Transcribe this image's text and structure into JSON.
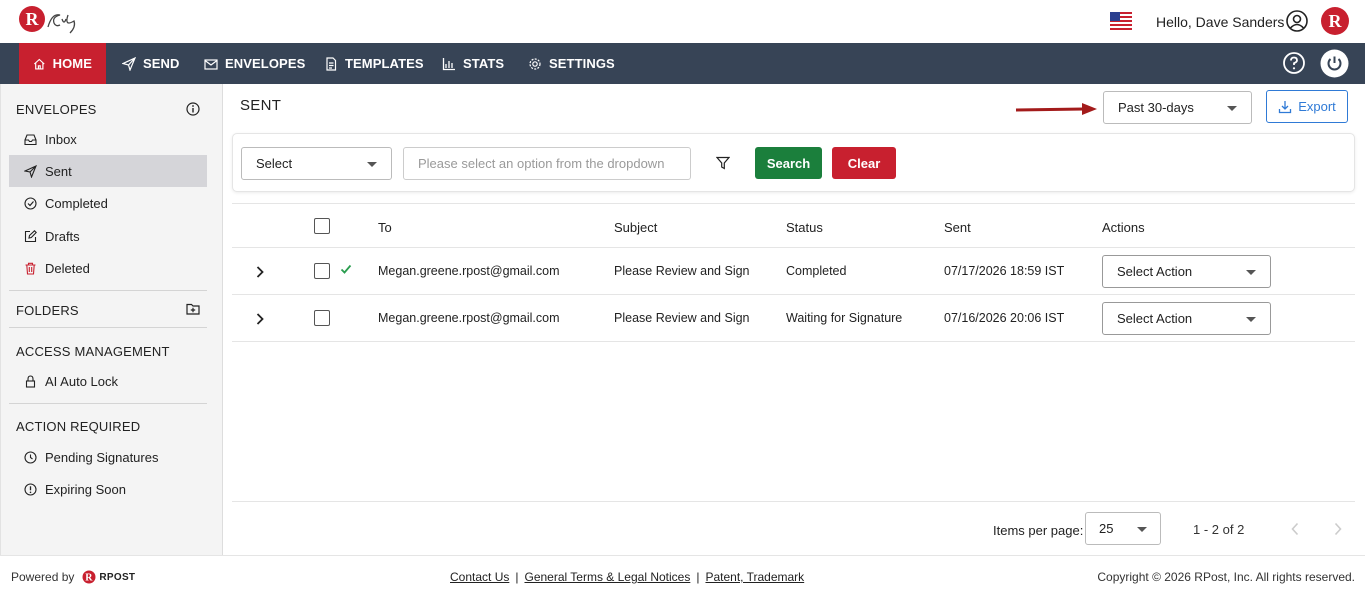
{
  "header": {
    "greeting": "Hello, Dave Sanders"
  },
  "nav": {
    "items": [
      {
        "label": "HOME",
        "icon": "home-icon",
        "active": true
      },
      {
        "label": "SEND",
        "icon": "send-icon"
      },
      {
        "label": "ENVELOPES",
        "icon": "envelope-icon"
      },
      {
        "label": "TEMPLATES",
        "icon": "document-icon"
      },
      {
        "label": "STATS",
        "icon": "bar-chart-icon"
      },
      {
        "label": "SETTINGS",
        "icon": "gear-icon"
      }
    ]
  },
  "sidebar": {
    "envelopes_heading": "ENVELOPES",
    "envelopes": [
      {
        "label": "Inbox",
        "icon": "inbox-icon"
      },
      {
        "label": "Sent",
        "icon": "send-icon",
        "active": true
      },
      {
        "label": "Completed",
        "icon": "check-circle-icon"
      },
      {
        "label": "Drafts",
        "icon": "edit-icon"
      },
      {
        "label": "Deleted",
        "icon": "trash-icon"
      }
    ],
    "folders_heading": "FOLDERS",
    "access_heading": "ACCESS MANAGEMENT",
    "access_items": [
      {
        "label": "AI Auto Lock",
        "icon": "lock-icon"
      }
    ],
    "action_heading": "ACTION REQUIRED",
    "action_items": [
      {
        "label": "Pending Signatures",
        "icon": "clock-icon"
      },
      {
        "label": "Expiring Soon",
        "icon": "alert-icon"
      }
    ]
  },
  "main": {
    "title": "SENT",
    "period": "Past 30-days",
    "export_label": "Export"
  },
  "filter": {
    "select_label": "Select",
    "search_placeholder": "Please select an option from the dropdown",
    "search_label": "Search",
    "clear_label": "Clear"
  },
  "table": {
    "columns": [
      "To",
      "Subject",
      "Status",
      "Sent",
      "Actions"
    ],
    "rows": [
      {
        "to": "Megan.greene.rpost@gmail.com",
        "subject": "Please Review and Sign",
        "status": "Completed",
        "sent": "07/17/2026 18:59 IST",
        "action": "Select Action",
        "completed_check": true
      },
      {
        "to": "Megan.greene.rpost@gmail.com",
        "subject": "Please Review and Sign",
        "status": "Waiting for Signature",
        "sent": "07/16/2026 20:06 IST",
        "action": "Select Action",
        "completed_check": false
      }
    ]
  },
  "pager": {
    "items_per_page_label": "Items per page:",
    "items_per_page": "25",
    "range": "1 - 2 of 2"
  },
  "footer": {
    "powered_by": "Powered by",
    "rpost_label": "RPOST",
    "links": [
      "Contact Us",
      "General Terms & Legal Notices",
      "Patent, Trademark"
    ],
    "separator": "|",
    "copyright": "Copyright © 2026 RPost, Inc. All rights reserved."
  },
  "colors": {
    "brand_red": "#c8202f",
    "nav_bg": "#374456",
    "search_green": "#1b7f3c",
    "export_blue": "#2f7ad6"
  }
}
